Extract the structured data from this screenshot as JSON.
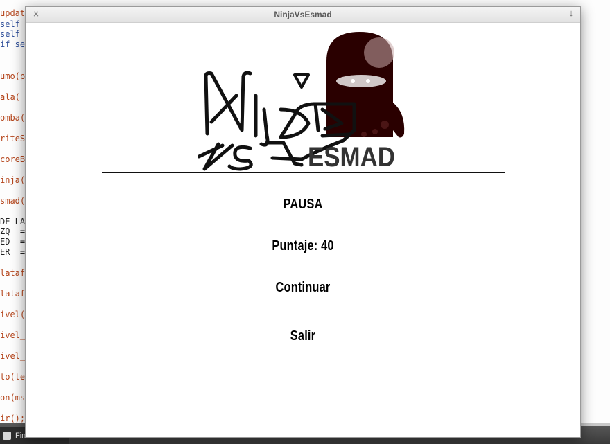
{
  "window": {
    "title": "NinjaVsEsmad",
    "close_glyph": "×",
    "minimize_glyph": "⤓"
  },
  "background_code": {
    "lines": [
      "updat",
      "self",
      "self",
      "if se",
      "umo(py",
      "ala( p",
      "omba(",
      "riteS",
      "coreBo",
      "inja(",
      "smad(",
      "DE LAS",
      "ZQ  =",
      "ED  =",
      "ER  =",
      "latafo",
      "latafo",
      "ivel(c",
      "ivel_(",
      "ivel_(",
      "to(tex",
      "on(msg",
      "ir();"
    ]
  },
  "taskbar": {
    "item_label": "Fin"
  },
  "logo": {
    "text_vs": "VS",
    "text_esmad": "ESMAD",
    "icon": "ninja-logo"
  },
  "menu": {
    "pause": "PAUSA",
    "score": "Puntaje: 40",
    "continue": "Continuar",
    "exit": "Salir"
  },
  "colors": {
    "ninja_body": "#2a0000",
    "ninja_highlight": "#c9a9a9",
    "logo_ink": "#111111",
    "esmad_text": "#333333"
  }
}
